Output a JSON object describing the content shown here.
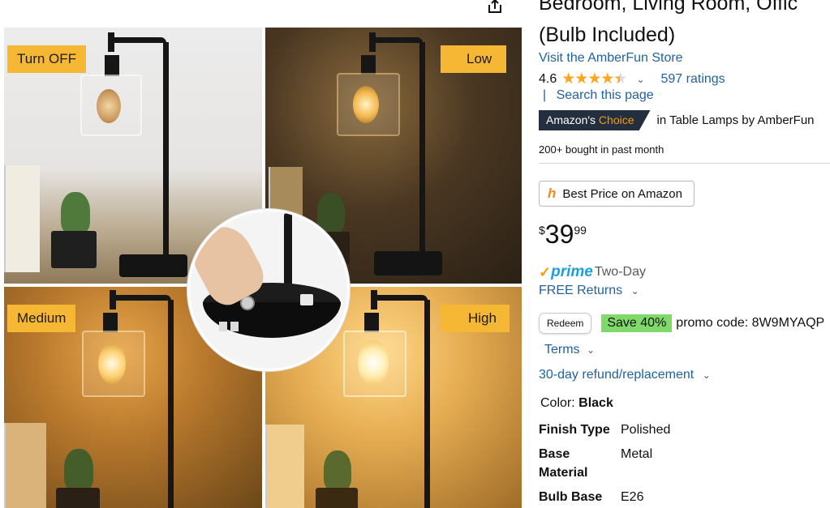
{
  "gallery": {
    "tags": {
      "top_left": "Turn OFF",
      "top_right": "Low",
      "bottom_left": "Medium",
      "bottom_right": "High"
    }
  },
  "product": {
    "title_line1": "Bedroom, Living Room, Offic",
    "title_line2": "(Bulb Included)",
    "store_link": "Visit the AmberFun Store",
    "rating_value": "4.6",
    "rating_stars": 4.5,
    "ratings_count": "597 ratings",
    "search_sep": "|",
    "search_link": "Search this page",
    "badge_prefix": "Amazon's",
    "badge_choice": "Choice",
    "badge_category": "in Table Lamps by AmberFun",
    "bought": "200+ bought in past month",
    "honey_button": "Best Price on Amazon",
    "price_symbol": "$",
    "price_whole": "39",
    "price_fraction": "99",
    "prime_word": "prime",
    "prime_two_day": "Two-Day",
    "free_returns": "FREE Returns",
    "redeem": "Redeem",
    "save_badge": "Save 40%",
    "promo_code": "promo code: 8W9MYAQP",
    "terms": "Terms",
    "refund": "30-day refund/replacement",
    "color_label": "Color:",
    "color_value": "Black"
  },
  "specs": [
    {
      "key": "Finish Type",
      "value": "Polished"
    },
    {
      "key": "Base Material",
      "value": "Metal"
    },
    {
      "key": "Bulb Base",
      "value": "E26"
    }
  ],
  "colors": {
    "link": "#2162a1",
    "badge_bg": "#232f3e",
    "badge_accent": "#ff9900",
    "save_bg": "#7fda69",
    "tag_bg": "#f6b735",
    "star": "#ffa41c"
  }
}
